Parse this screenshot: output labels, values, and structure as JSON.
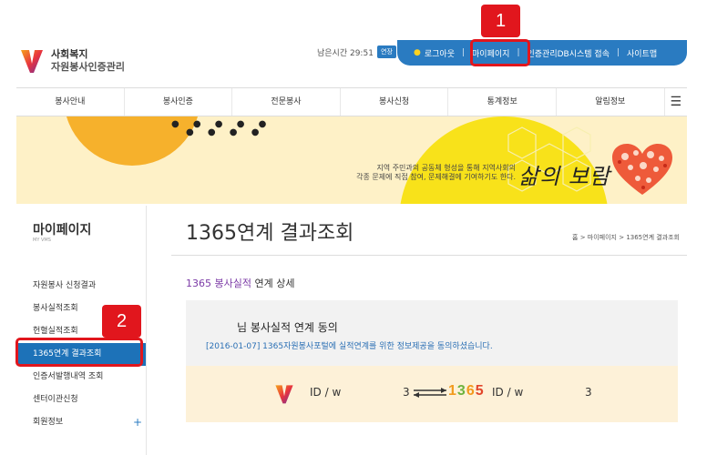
{
  "brand": {
    "line1": "사회복지",
    "line2": "자원봉사인증관리"
  },
  "session": {
    "remaining_label": "남은시간 29:51",
    "extend_label": "연장"
  },
  "topbar": {
    "logout": "로그아웃",
    "mypage": "마이페이지",
    "db_access": "인증관리DB시스템 접속",
    "sitemap": "사이트맵"
  },
  "annotations": {
    "one": "1",
    "two": "2"
  },
  "nav": {
    "items": [
      "봉사안내",
      "봉사인증",
      "전문봉사",
      "봉사신청",
      "통계정보",
      "알림정보"
    ]
  },
  "banner": {
    "copy_line1": "지역 주민과의 공동체 형성을 통해 지역사회의",
    "copy_line2": "각종 문제에 직접 참여, 문제해결에 기여하기도 한다.",
    "slogan": "삶의 보람"
  },
  "sidebar": {
    "title": "마이페이지",
    "subtitle": "MY VMS",
    "items": [
      {
        "label": "자원봉사 신청결과"
      },
      {
        "label": "봉사실적조회"
      },
      {
        "label": "헌혈실적조회"
      },
      {
        "label": "1365연계 결과조회"
      },
      {
        "label": "인증서발행내역 조회"
      },
      {
        "label": "센터이관신청"
      },
      {
        "label": "회원정보"
      }
    ]
  },
  "main": {
    "title": "1365연계 결과조회",
    "breadcrumb": "홈 > 마이페이지 > 1365연계 결과조회",
    "section_prefix": "1365 봉사실적",
    "section_suffix": " 연계 상세",
    "agree_title": "님 봉사실적 연계 동의",
    "agree_desc": "[2016-01-07] 1365자원봉사포털에 실적연계를 위한 정보제공을 동의하셨습니다.",
    "id_left": "ID / w",
    "digit_left": "3",
    "logo_1365": "1365",
    "id_right": "ID / w",
    "digit_right": "3"
  },
  "colors": {
    "primary_blue": "#2a7bc1",
    "active_blue": "#1d72b8",
    "annotation_red": "#e1161d",
    "accent_purple": "#7b3aa6"
  }
}
